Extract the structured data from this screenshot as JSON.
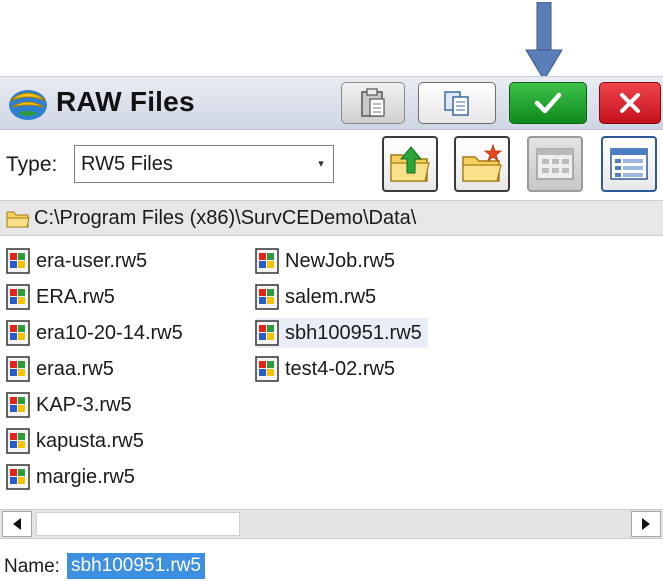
{
  "window": {
    "title": "RAW Files"
  },
  "toolbar": {
    "icons": {
      "clipboard": "clipboard-icon",
      "copy": "copy-icon",
      "ok": "checkmark-icon",
      "close": "close-icon"
    }
  },
  "type": {
    "label": "Type:",
    "value": "RW5 Files"
  },
  "view_buttons": {
    "up": "folder-up-icon",
    "new_folder": "new-folder-icon",
    "grid": "grid-view-icon",
    "list": "list-view-icon"
  },
  "path": "C:\\Program Files (x86)\\SurvCEDemo\\Data\\",
  "files": [
    {
      "name": "era-user.rw5"
    },
    {
      "name": "ERA.rw5"
    },
    {
      "name": "era10-20-14.rw5"
    },
    {
      "name": "eraa.rw5"
    },
    {
      "name": "KAP-3.rw5"
    },
    {
      "name": "kapusta.rw5"
    },
    {
      "name": "margie.rw5"
    },
    {
      "name": "NewJob.rw5"
    },
    {
      "name": "salem.rw5"
    },
    {
      "name": "sbh100951.rw5",
      "selected": true
    },
    {
      "name": "test4-02.rw5"
    }
  ],
  "name_field": {
    "label": "Name:",
    "value": "sbh100951.rw5"
  },
  "colors": {
    "ok": "#1ea52b",
    "close": "#d91c25",
    "selection": "#3d8fe0",
    "arrow": "#5a7fb8"
  }
}
